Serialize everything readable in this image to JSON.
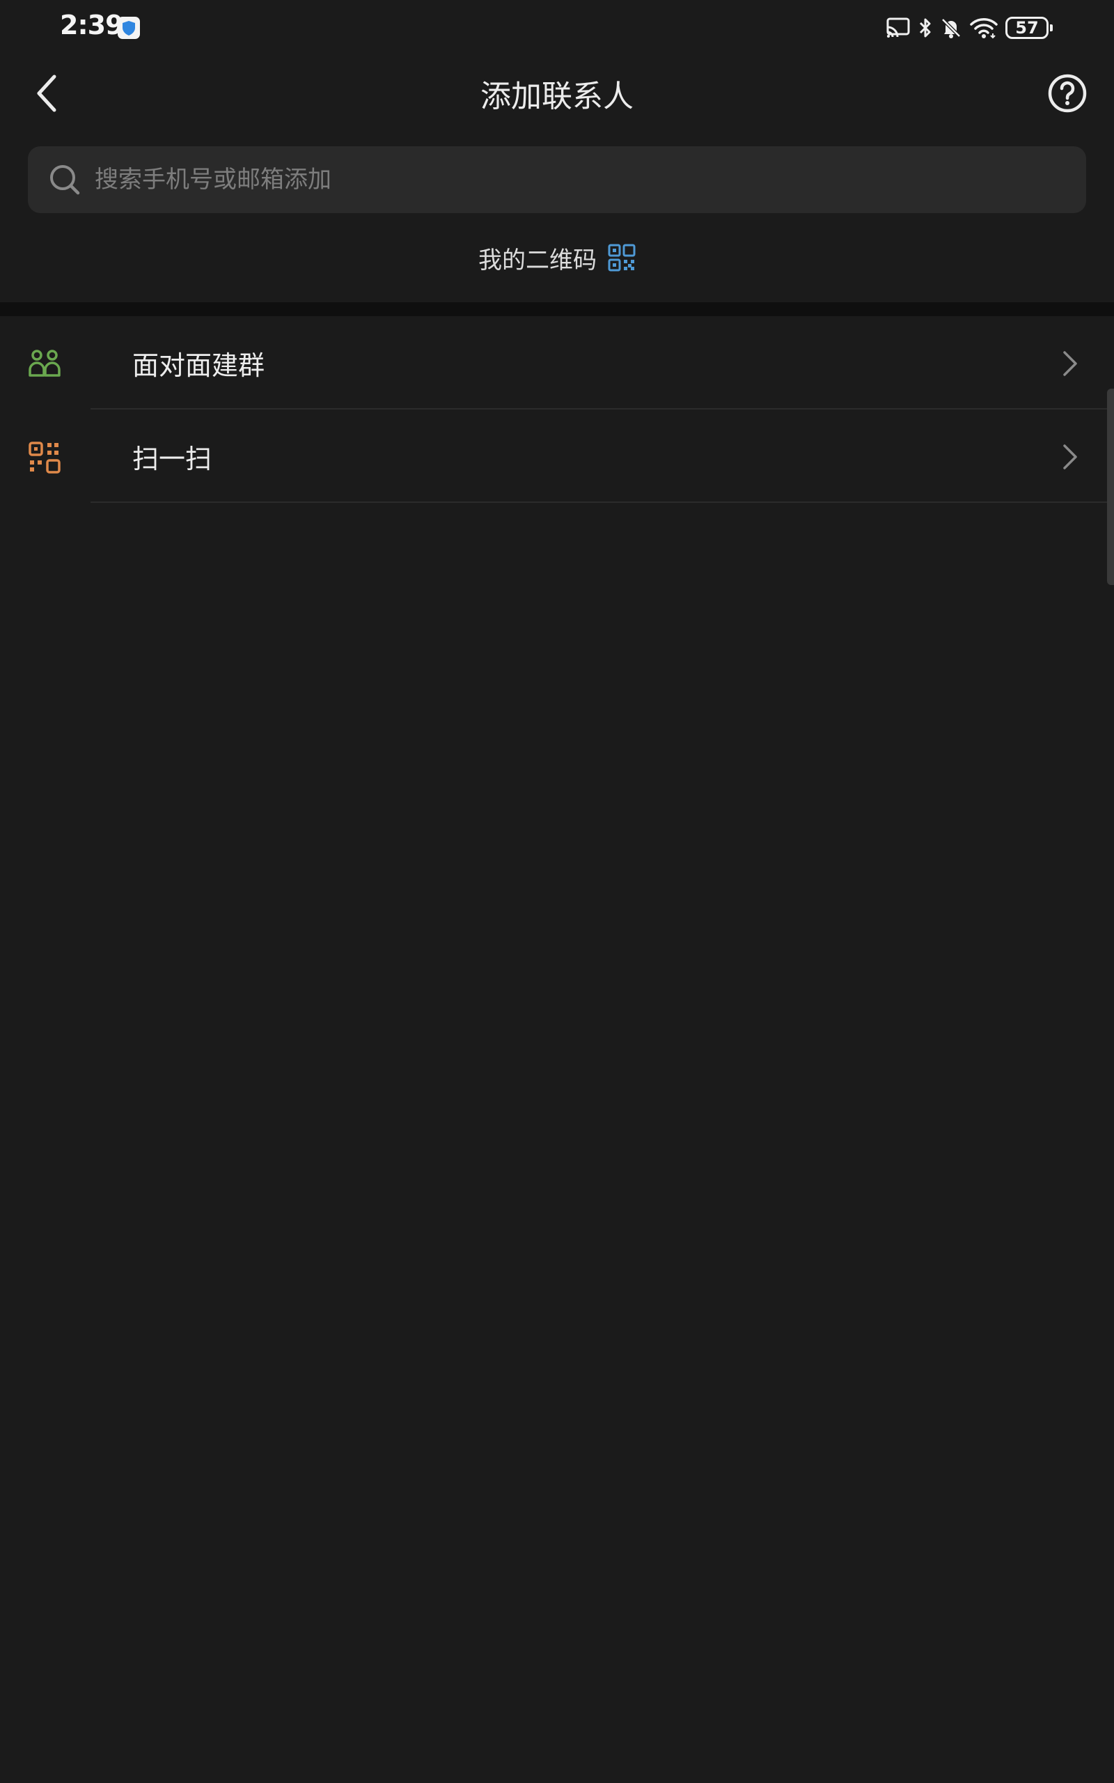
{
  "status_bar": {
    "time": "2:39",
    "battery": "57",
    "icons": [
      "cast-icon",
      "bluetooth-icon",
      "mute-icon",
      "wifi-icon",
      "battery-icon"
    ]
  },
  "header": {
    "title": "添加联系人"
  },
  "search": {
    "placeholder": "搜索手机号或邮箱添加"
  },
  "my_qr": {
    "label": "我的二维码"
  },
  "list": {
    "items": [
      {
        "label": "面对面建群",
        "icon": "group-people-icon",
        "icon_color": "#6aa84f"
      },
      {
        "label": "扫一扫",
        "icon": "scan-icon",
        "icon_color": "#e0894a"
      }
    ]
  },
  "colors": {
    "background": "#1b1b1b",
    "search_bg": "#2a2a2a",
    "qr_accent": "#4f9ad6",
    "group_icon": "#6aa84f",
    "scan_icon": "#e0894a"
  }
}
